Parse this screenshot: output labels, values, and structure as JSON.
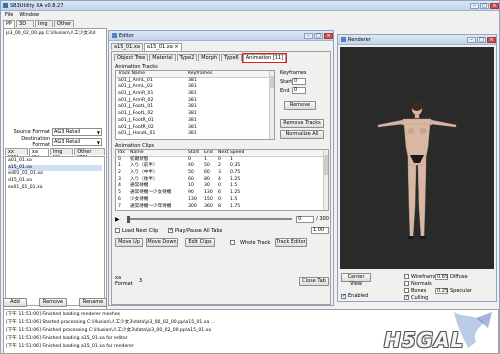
{
  "main": {
    "title": "SB3Utility XA v0.8.27",
    "menu": [
      "File",
      "Window"
    ],
    "tabs": [
      "PP",
      "3D",
      "Img",
      "Other"
    ],
    "pp_file": "js3_00_02_00.pp  C:\\illusion\\人工少女3\\d",
    "source_format_label": "Source Format",
    "source_format": "AG3 Retail",
    "dest_format_label": "Destination Format",
    "dest_format": "AG3 Retail",
    "subtabs": [
      "xx [86]",
      "xa [5]",
      "Img [0]",
      "Other [75]"
    ],
    "files": [
      "a01_01.xa",
      "a15_01.xa",
      "ed01_01_01.xa",
      "d15_01.xa",
      "ex01_01_01.xa"
    ],
    "buttons": [
      "Add",
      "Remove",
      "Rename"
    ]
  },
  "editor": {
    "title": "Editor",
    "doc_tabs": [
      "a15_01.xa",
      "a15_01.xa ×"
    ],
    "tabs": [
      "Object Tree",
      "Material",
      "Type2",
      "Morph",
      "Type6",
      "Animation [11]"
    ],
    "tracks_label": "Animation Tracks",
    "tracks_cols": [
      "Track Name",
      "Keyframes"
    ],
    "tracks": [
      [
        "a01_J_ArmL_01",
        "381"
      ],
      [
        "a01_J_ArmL_02",
        "381"
      ],
      [
        "a01_J_ArmR_01",
        "381"
      ],
      [
        "a01_J_ArmR_02",
        "381"
      ],
      [
        "a01_J_FootL_01",
        "381"
      ],
      [
        "a01_J_FootL_02",
        "381"
      ],
      [
        "a01_J_FootR_01",
        "381"
      ],
      [
        "a01_J_FootR_02",
        "381"
      ],
      [
        "a01_J_HandL_01",
        "381"
      ]
    ],
    "keyframes_label": "Keyframes",
    "start_label": "Start",
    "start_value": "0",
    "end_label": "End",
    "end_value": "0",
    "remove_label": "Remove",
    "remove_tracks_label": "Remove Tracks",
    "normalize_label": "Normalize All",
    "clips_label": "Animation Clips",
    "clips_cols": [
      "Idx",
      "Name",
      "Start",
      "End",
      "Next",
      "Speed"
    ],
    "clips": [
      [
        "0",
        "初期状態",
        "0",
        "1",
        "0",
        "1"
      ],
      [
        "1",
        "入り（前半）",
        "40",
        "50",
        "2",
        "0.35"
      ],
      [
        "2",
        "入り（中半）",
        "50",
        "60",
        "3",
        "0.75"
      ],
      [
        "3",
        "入り（後半）",
        "60",
        "80",
        "4",
        "1.25"
      ],
      [
        "4",
        "通常待機",
        "10",
        "30",
        "0",
        "1.5"
      ],
      [
        "5",
        "通常待機〜少女待機",
        "90",
        "130",
        "6",
        "1.25"
      ],
      [
        "6",
        "少女待機",
        "130",
        "150",
        "0",
        "1.5"
      ],
      [
        "7",
        "通常待機〜少年待機",
        "300",
        "360",
        "8",
        "1.75"
      ]
    ],
    "frame_value": "0",
    "frame_total": "/ 300",
    "load_next_label": "Load Next Clip",
    "play_pause_label": "Play/Pause All Tabs",
    "speed_value": "1.00",
    "move_up_label": "Move Up",
    "move_down_label": "Move Down",
    "edit_clips_label": "Edit Clips",
    "whole_track_label": "Whole Track",
    "track_editor_label": "Track Editor",
    "format_label": "xa Format",
    "format_value": "3",
    "close_tab_label": "Close Tab"
  },
  "renderer": {
    "title": "Renderer",
    "center_view_label": "Center View",
    "wireframe_label": "Wireframe",
    "normals_label": "Normals",
    "bones_label": "Bones",
    "culling_label": "Culling",
    "enabled_label": "Enabled",
    "diffuse_value": "0.65",
    "diffuse_label": "Diffuse",
    "specular_value": "0.25",
    "specular_label": "Specular",
    "ambient_value": "0.25",
    "ambient_label": "Ambient"
  },
  "log": {
    "lines": [
      "[下午 11:51:00] Finished loading renderer meshes",
      "[下午 11:51:06] Started processing C:\\illusion\\人工少女3\\data\\js3_00_02_00.pp\\a15_01.xa ...",
      "[下午 11:51:06] Finished processing C:\\illusion\\人工少女3\\data\\js3_00_02_00.pp\\a15_01.xa",
      "[下午 11:51:06] Finished loading a15_01.xa for editor",
      "[下午 11:51:06] Finished loading a15_01.xa for renderer"
    ]
  },
  "watermark": "H5GAL"
}
